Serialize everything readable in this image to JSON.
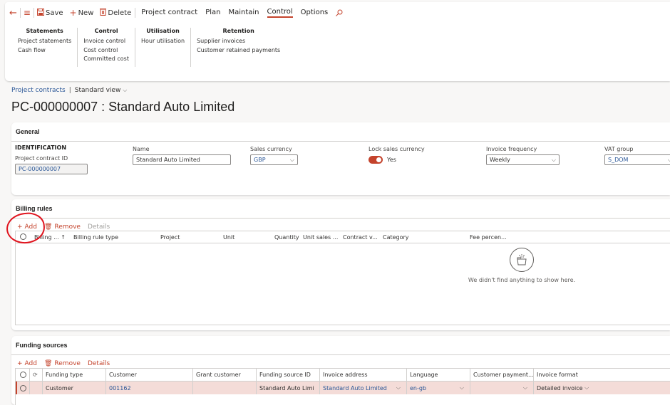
{
  "toolbar": {
    "back_icon": "back-arrow-icon",
    "menu_icon": "hamburger-icon",
    "save_label": "Save",
    "new_label": "New",
    "delete_label": "Delete",
    "tabs": [
      "Project contract",
      "Plan",
      "Maintain",
      "Control",
      "Options"
    ],
    "active_tab": "Control",
    "search_icon": "search-icon"
  },
  "ribbon": {
    "groups": [
      {
        "title": "Statements",
        "items": [
          "Project statements",
          "Cash flow"
        ]
      },
      {
        "title": "Control",
        "items": [
          "Invoice control",
          "Cost control",
          "Committed cost"
        ]
      },
      {
        "title": "Utilisation",
        "items": [
          "Hour utilisation"
        ]
      },
      {
        "title": "Retention",
        "items": [
          "Supplier invoices",
          "Customer retained payments"
        ]
      }
    ]
  },
  "breadcrumb": {
    "link": "Project contracts",
    "separator": "|",
    "view": "Standard view"
  },
  "page_title": "PC-000000007 : Standard Auto Limited",
  "general": {
    "header": "General",
    "identification_title": "IDENTIFICATION",
    "fields": {
      "contract_id": {
        "label": "Project contract ID",
        "value": "PC-000000007"
      },
      "name": {
        "label": "Name",
        "value": "Standard Auto Limited"
      },
      "sales_currency": {
        "label": "Sales currency",
        "value": "GBP"
      },
      "lock_sales_currency": {
        "label": "Lock sales currency",
        "value": "Yes",
        "on": true
      },
      "invoice_frequency": {
        "label": "Invoice frequency",
        "value": "Weekly"
      },
      "vat_group": {
        "label": "VAT group",
        "value": "S_DOM"
      }
    }
  },
  "billing_rules": {
    "header": "Billing rules",
    "actions": {
      "add": "Add",
      "remove": "Remove",
      "details": "Details"
    },
    "columns": [
      "Billing ...",
      "Billing rule type",
      "Project",
      "Unit",
      "Quantity",
      "Unit sales ...",
      "Contract v...",
      "Category",
      "Fee percen..."
    ],
    "sort_indicator": "↑",
    "empty_message": "We didn't find anything to show here."
  },
  "funding_sources": {
    "header": "Funding sources",
    "actions": {
      "add": "Add",
      "remove": "Remove",
      "details": "Details"
    },
    "columns": [
      "Funding type",
      "Customer",
      "Grant customer",
      "Funding source ID",
      "Invoice address",
      "Language",
      "Customer payment...",
      "Invoice format"
    ],
    "rows": [
      {
        "funding_type": "Customer",
        "customer": "001162",
        "grant_customer": "",
        "funding_source_id": "Standard Auto Limi",
        "invoice_address": "Standard Auto Limited",
        "language": "en-gb",
        "customer_payment": "",
        "invoice_format": "Detailed invoice"
      }
    ]
  },
  "colors": {
    "accent": "#c4432c",
    "link": "#2b5797",
    "selected_row": "#f4dcd8",
    "annotation": "#e0141e"
  }
}
